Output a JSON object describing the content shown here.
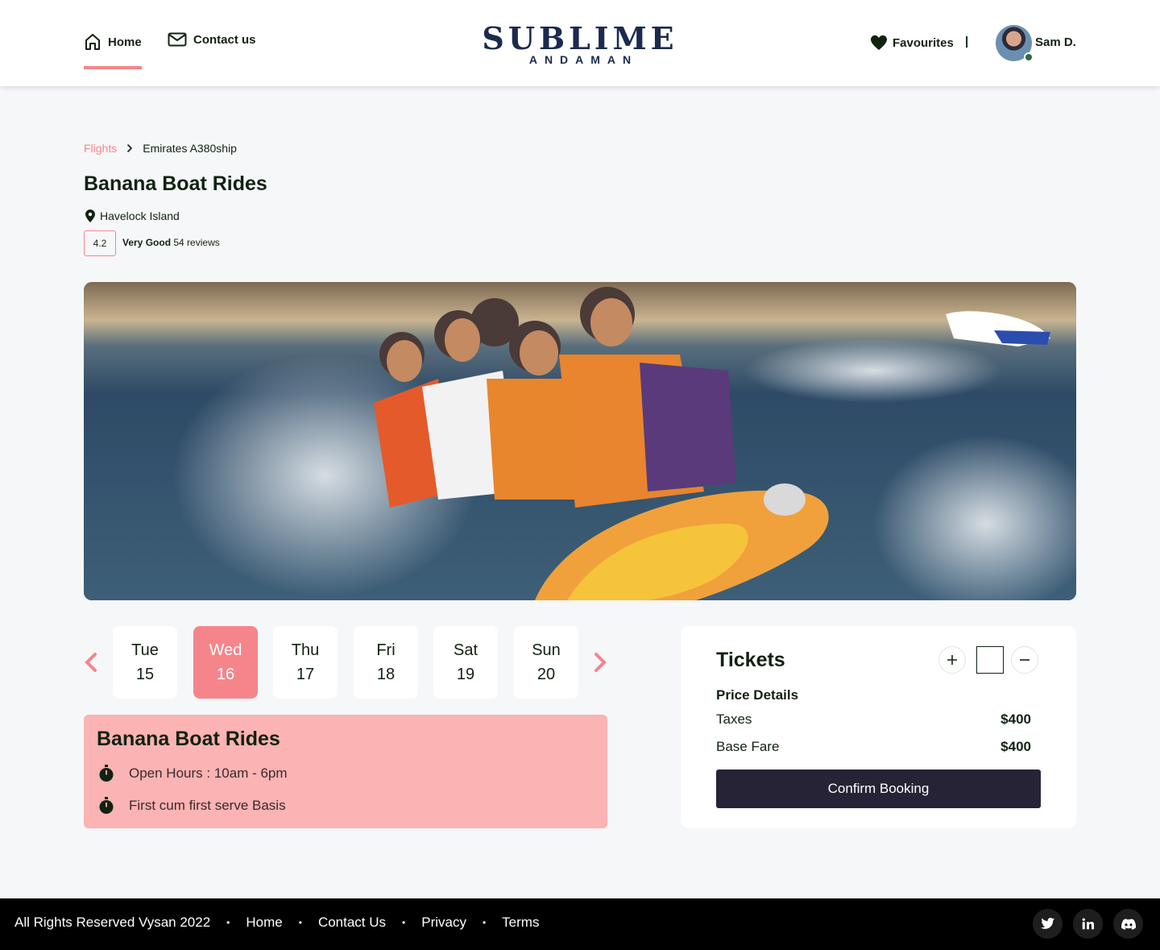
{
  "header": {
    "nav": {
      "home": "Home",
      "contact": "Contact us"
    },
    "logo": {
      "main": "SUBLIME",
      "sub": "ANDAMAN"
    },
    "favourites": "Favourites",
    "separator": "|",
    "user_name": "Sam D."
  },
  "breadcrumb": {
    "parent": "Flights",
    "current": "Emirates A380ship"
  },
  "page_title": "Banana Boat Rides",
  "location": "Havelock Island",
  "rating": {
    "score": "4.2",
    "label": "Very Good",
    "reviews": "54 reviews"
  },
  "dates": [
    {
      "dow": "Tue",
      "num": "15"
    },
    {
      "dow": "Wed",
      "num": "16"
    },
    {
      "dow": "Thu",
      "num": "17"
    },
    {
      "dow": "Fri",
      "num": "18"
    },
    {
      "dow": "Sat",
      "num": "19"
    },
    {
      "dow": "Sun",
      "num": "20"
    }
  ],
  "selected_date_index": 1,
  "info": {
    "title": "Banana Boat Rides",
    "open_hours": "Open Hours : 10am - 6pm",
    "serve": "First cum first serve Basis"
  },
  "tickets": {
    "title": "Tickets",
    "quantity": "",
    "price_details": "Price Details",
    "taxes_label": "Taxes",
    "taxes_value": "$400",
    "base_fare_label": "Base Fare",
    "base_fare_value": "$400",
    "confirm": "Confirm Booking"
  },
  "footer": {
    "copyright": "All Rights Reserved Vysan 2022",
    "links": [
      "Home",
      "Contact Us",
      "Privacy",
      "Terms"
    ],
    "social": [
      "twitter-icon",
      "linkedin-icon",
      "discord-icon"
    ]
  },
  "colors": {
    "accent": "#f5858a",
    "info_card": "#fbb3b3",
    "dark_button": "#262336",
    "logo": "#1b2a4e"
  }
}
